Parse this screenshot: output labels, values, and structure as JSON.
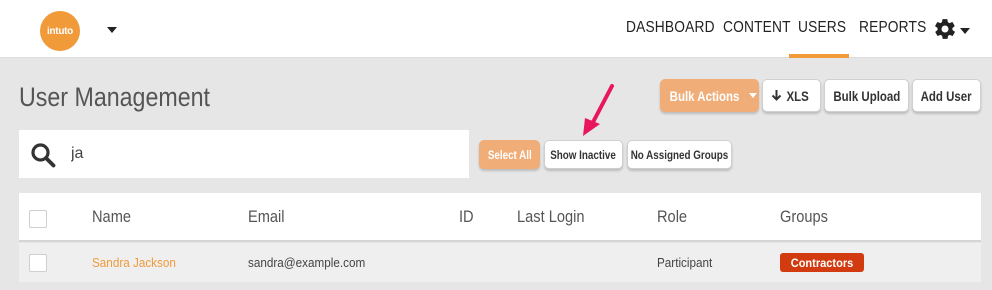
{
  "brand": {
    "logo_text": "intuto",
    "color": "#f09a3a"
  },
  "nav": {
    "items": [
      {
        "label": "DASHBOARD"
      },
      {
        "label": "CONTENT"
      },
      {
        "label": "USERS",
        "active": true
      },
      {
        "label": "REPORTS"
      }
    ],
    "settings_icon": "gear-icon"
  },
  "page": {
    "title": "User Management"
  },
  "toolbar": {
    "bulk_actions": "Bulk Actions",
    "xls": "XLS",
    "bulk_upload": "Bulk Upload",
    "add_user": "Add User"
  },
  "search": {
    "value": "ja",
    "icon": "search-icon"
  },
  "filters": {
    "select_all": "Select All",
    "show_inactive": "Show Inactive",
    "no_assigned_groups": "No Assigned Groups"
  },
  "table": {
    "columns": [
      "Name",
      "Email",
      "ID",
      "Last Login",
      "Role",
      "Groups"
    ],
    "rows": [
      {
        "name": "Sandra Jackson",
        "email": "sandra@example.com",
        "id": "",
        "last_login": "",
        "role": "Participant",
        "group": "Contractors"
      }
    ]
  },
  "colors": {
    "accent": "#f09a3a",
    "button_orange": "#f0ad78",
    "badge_red": "#d13b0f",
    "arrow": "#e8175d"
  }
}
